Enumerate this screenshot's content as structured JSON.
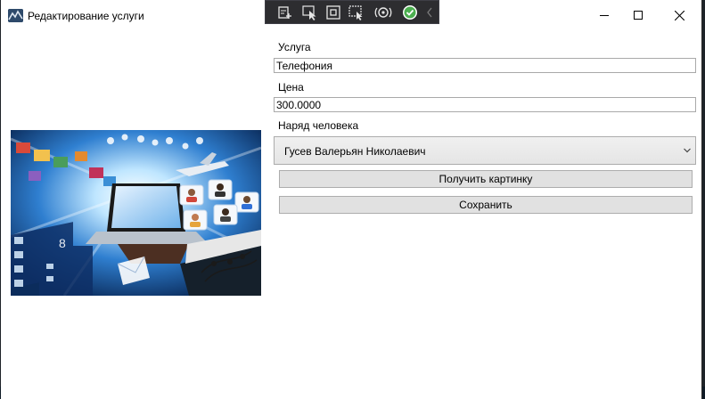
{
  "window": {
    "title": "Редактирование услуги"
  },
  "devtools": {
    "tools": [
      "live-visual-tree-icon",
      "select-element-icon",
      "display-layout-adorners-icon",
      "track-focused-element-icon",
      "hot-reload-icon",
      "binding-ok-icon",
      "collapse-chevron-icon"
    ]
  },
  "form": {
    "service_label": "Услуга",
    "service_value": "Телефония",
    "price_label": "Цена",
    "price_value": "300.0000",
    "crew_label": "Наряд человека",
    "crew_selected": "Гусев Валерьян Николаевич",
    "get_picture_button": "Получить картинку",
    "save_button": "Сохранить"
  },
  "colors": {
    "window_bg": "#ffffff",
    "button_bg": "#e1e1e1",
    "devtools_bg": "#2d2d30",
    "check_green": "#4caf50",
    "picture_accent": "#1e5fb4"
  }
}
